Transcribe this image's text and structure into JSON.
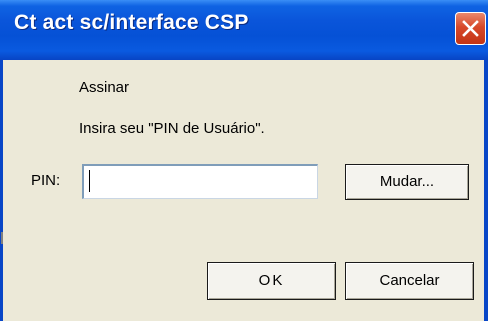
{
  "window": {
    "title": "Ct act sc/interface CSP",
    "close_icon": "close-icon"
  },
  "dialog": {
    "heading": "Assinar",
    "instruction": "Insira seu \"PIN de Usuário\".",
    "pin_label": "PIN:",
    "pin_value": "",
    "change_button": "Mudar...",
    "ok_button": "OK",
    "cancel_button": "Cancelar"
  },
  "colors": {
    "titlebar": "#0A55DA",
    "frame": "#0846C7",
    "body": "#ECE9D8",
    "close_button": "#D8492A"
  }
}
